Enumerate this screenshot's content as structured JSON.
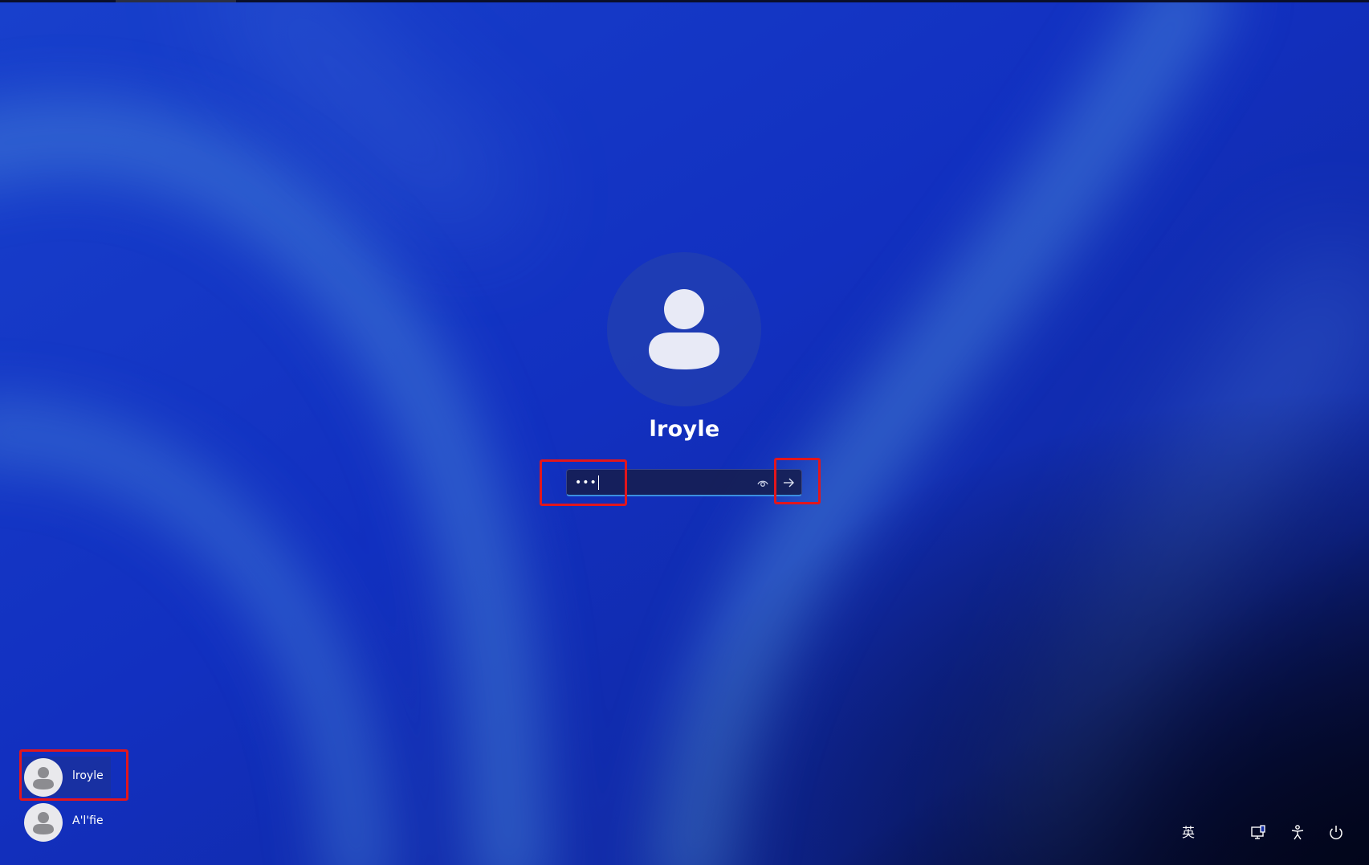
{
  "lock_screen": {
    "user_name": "lroyle",
    "password": {
      "masked_value": "•••",
      "reveal_icon": "eye-icon",
      "submit_icon": "arrow-right-icon"
    }
  },
  "user_list": [
    {
      "name": "lroyle",
      "selected": true,
      "icon": "person-icon"
    },
    {
      "name": "A'l'fie",
      "selected": false,
      "icon": "person-icon"
    }
  ],
  "status_bar": {
    "input_method": "英",
    "icons": [
      "network-icon",
      "accessibility-icon",
      "power-icon"
    ]
  },
  "colors": {
    "wallpaper_base": "#1633c4",
    "accent_underline": "#3b8fe0",
    "annotation_red": "#e3161c"
  }
}
